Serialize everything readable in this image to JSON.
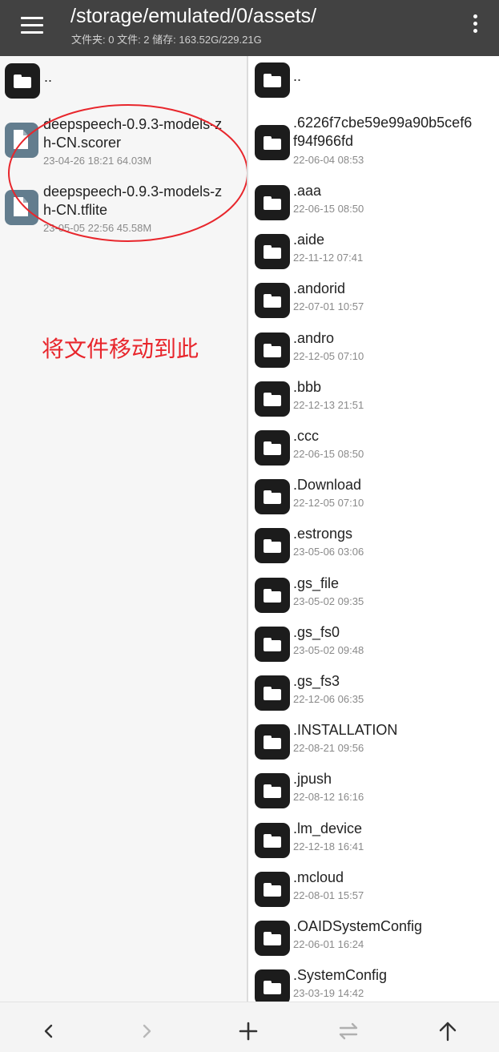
{
  "header": {
    "title": "/storage/emulated/0/assets/",
    "subtitle": "文件夹: 0  文件: 2  储存: 163.52G/229.21G"
  },
  "left_pane": {
    "items": [
      {
        "type": "folder",
        "name": "..",
        "meta": ""
      },
      {
        "type": "file",
        "name_line1": "deepspeech-0.9.3-models-z",
        "name_line2": "h-CN.scorer",
        "meta": "23-04-26 18:21  64.03M"
      },
      {
        "type": "file",
        "name_line1": "deepspeech-0.9.3-models-z",
        "name_line2": "h-CN.tflite",
        "meta": "23-05-05 22:56  45.58M"
      }
    ],
    "annotation": "将文件移动到此"
  },
  "right_pane": {
    "items": [
      {
        "name": "..",
        "meta": ""
      },
      {
        "name_line1": ".6226f7cbe59e99a90b5cef6",
        "name_line2": "f94f966fd",
        "meta": "22-06-04 08:53"
      },
      {
        "name": ".aaa",
        "meta": "22-06-15 08:50"
      },
      {
        "name": ".aide",
        "meta": "22-11-12 07:41"
      },
      {
        "name": ".andorid",
        "meta": "22-07-01 10:57"
      },
      {
        "name": ".andro",
        "meta": "22-12-05 07:10"
      },
      {
        "name": ".bbb",
        "meta": "22-12-13 21:51"
      },
      {
        "name": ".ccc",
        "meta": "22-06-15 08:50"
      },
      {
        "name": ".Download",
        "meta": "22-12-05 07:10"
      },
      {
        "name": ".estrongs",
        "meta": "23-05-06 03:06"
      },
      {
        "name": ".gs_file",
        "meta": "23-05-02 09:35"
      },
      {
        "name": ".gs_fs0",
        "meta": "23-05-02 09:48"
      },
      {
        "name": ".gs_fs3",
        "meta": "22-12-06 06:35"
      },
      {
        "name": ".INSTALLATION",
        "meta": "22-08-21 09:56"
      },
      {
        "name": ".jpush",
        "meta": "22-08-12 16:16"
      },
      {
        "name": ".lm_device",
        "meta": "22-12-18 16:41"
      },
      {
        "name": ".mcloud",
        "meta": "22-08-01 15:57"
      },
      {
        "name": ".OAIDSystemConfig",
        "meta": "22-06-01 16:24"
      },
      {
        "name": ".SystemConfig",
        "meta": "23-03-19 14:42"
      }
    ]
  },
  "colors": {
    "header_bg": "#424242",
    "annotation_red": "#e8262c",
    "folder_icon": "#1c1c1c",
    "file_icon": "#637d8e"
  },
  "icons": {
    "menu": "hamburger-menu-icon",
    "more": "more-vertical-icon",
    "back": "chevron-left-icon",
    "forward": "chevron-right-icon",
    "add": "plus-icon",
    "swap": "swap-arrows-icon",
    "up": "arrow-up-icon"
  }
}
